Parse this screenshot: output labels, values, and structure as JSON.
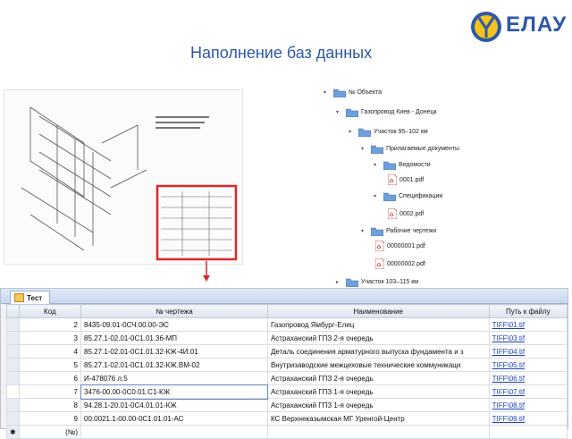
{
  "header": {
    "title": "Наполнение баз данных",
    "logo_text": "ЕЛАУ"
  },
  "tree": {
    "root": "№ Объекта",
    "items": [
      {
        "label": "Газопровод Киев - Донецк",
        "type": "folder"
      },
      {
        "label": "Участок 95–102 км",
        "type": "folder"
      },
      {
        "label": "Прилагаемые документы",
        "type": "folder"
      },
      {
        "label": "Ведомости",
        "type": "folder"
      },
      {
        "label": "0001.pdf",
        "type": "pdf"
      },
      {
        "label": "Спецификации",
        "type": "folder"
      },
      {
        "label": "0002.pdf",
        "type": "pdf"
      },
      {
        "label": "Рабочие чертежи",
        "type": "folder"
      },
      {
        "label": "00000001.pdf",
        "type": "pdf"
      },
      {
        "label": "00000002.pdf",
        "type": "pdf"
      },
      {
        "label": "Участок 103–115 км",
        "type": "folder"
      }
    ]
  },
  "table": {
    "tab_label": "Тест",
    "columns": [
      "Код",
      "№ чертежа",
      "Наименование",
      "Путь к файлу"
    ],
    "rows": [
      {
        "code": "2",
        "drawing": "8435-09.01-0СЧ.00.00-ЭС",
        "name": "Газопровод Ямбург-Елец",
        "path": "TIFF\\01.tif"
      },
      {
        "code": "3",
        "drawing": "85.27.1-02.01-0С1.01.36-МП",
        "name": "Астраханский ГПЗ 2-я очередь",
        "path": "TIFF\\03.tif"
      },
      {
        "code": "4",
        "drawing": "85.27.1-02.01-0С1.01.32-КЖ-4И.01",
        "name": "Деталь соединения арматурного выпуска фундамента и з",
        "path": "TIFF\\04.tif"
      },
      {
        "code": "5",
        "drawing": "85.27.1-02.01-0С1.01.32-КЖ.ВМ-02",
        "name": "Внутризаводские межцеховые технические коммуникаци",
        "path": "TIFF\\05.tif"
      },
      {
        "code": "6",
        "drawing": "И-478076 л.5",
        "name": "Астраханский ГПЗ 2-я очередь",
        "path": "TIFF\\06.tif"
      },
      {
        "code": "7",
        "drawing": "3476-00.00-0С0.01.С1-КЖ",
        "name": "Астраханский ГПЗ 1-я очередь",
        "path": "TIFF\\07.tif"
      },
      {
        "code": "8",
        "drawing": "94.28.1-20.01-0С4.01.01-КЖ",
        "name": "Астраханский ГПЗ 1-я очередь",
        "path": "TIFF\\08.tif"
      },
      {
        "code": "9",
        "drawing": "00.0021.1-00.00-0С1.01.01-АС",
        "name": "КС Верхнеказымская МГ Уренгой-Центр",
        "path": "TIFF\\09.tif"
      }
    ],
    "new_row_code": "(№)",
    "new_row_marker": "✱"
  }
}
